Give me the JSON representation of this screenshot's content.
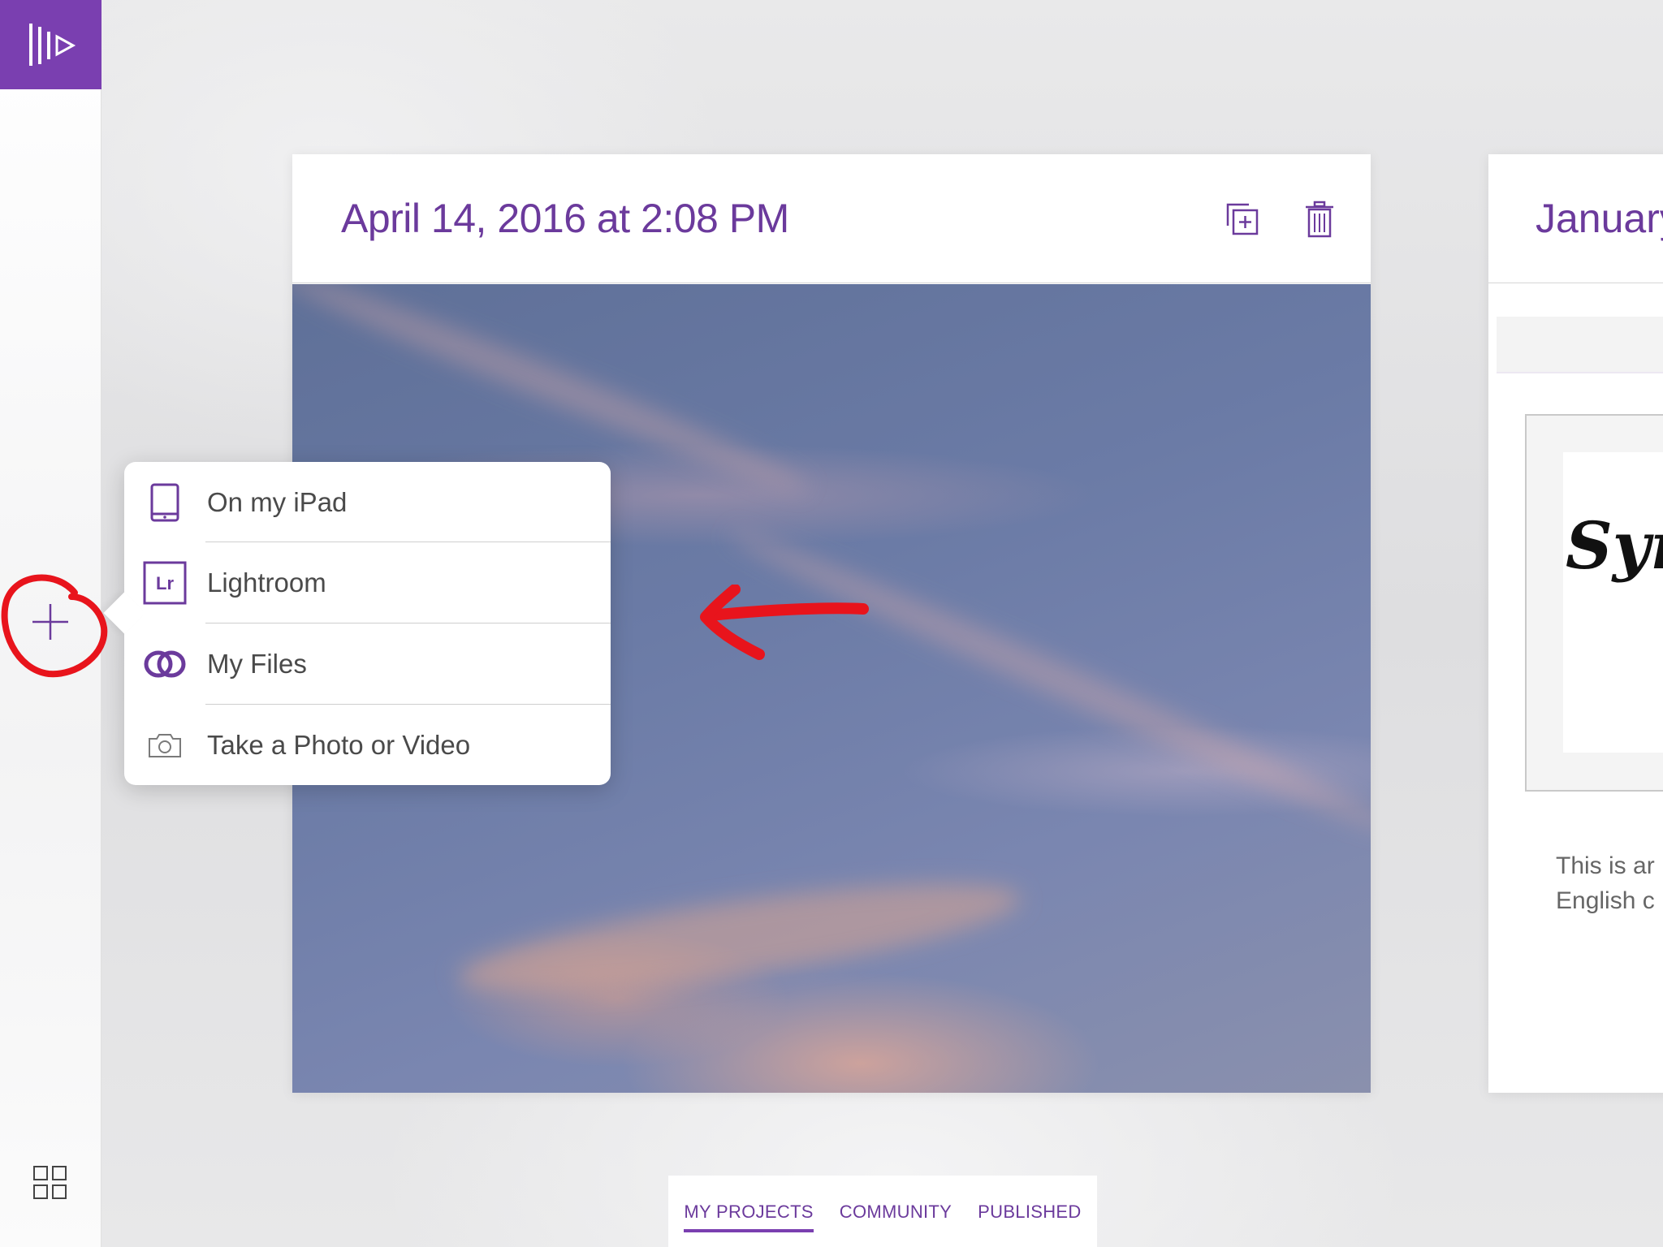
{
  "project_card": {
    "title": "April 14, 2016 at 2:08 PM",
    "actions": [
      "duplicate-icon",
      "trash-icon"
    ]
  },
  "peek_card": {
    "title": "January",
    "script_text": "Syr",
    "body_lines": [
      "This is ar",
      "English c"
    ]
  },
  "add_menu": {
    "items": [
      {
        "label": "On my iPad",
        "icon": "ipad-icon"
      },
      {
        "label": "Lightroom",
        "icon": "lightroom-icon",
        "icon_text": "Lr"
      },
      {
        "label": "My Files",
        "icon": "creative-cloud-icon"
      },
      {
        "label": "Take a Photo or Video",
        "icon": "camera-icon"
      }
    ]
  },
  "tabs": [
    {
      "label": "MY PROJECTS",
      "active": true
    },
    {
      "label": "COMMUNITY",
      "active": false
    },
    {
      "label": "PUBLISHED",
      "active": false
    }
  ],
  "colors": {
    "brand": "#7a3fb0",
    "title_text": "#6b3a9c",
    "annotation": "#e8141c"
  }
}
